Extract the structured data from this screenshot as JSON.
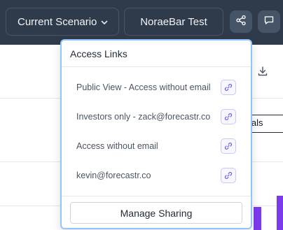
{
  "topbar": {
    "scenario_label": "Current Scenario",
    "project_label": "NoraeBar Test"
  },
  "background": {
    "toggle_label": "tuals"
  },
  "access_links": {
    "title": "Access Links",
    "links": [
      {
        "label": "Public View - Access without email"
      },
      {
        "label": "Investors only - zack@forecastr.co"
      },
      {
        "label": "Access without email"
      },
      {
        "label": "kevin@forecastr.co"
      }
    ],
    "manage_label": "Manage Sharing"
  },
  "colors": {
    "topbar_bg": "#2f3a4b",
    "popover_border": "#93c5fd",
    "link_icon": "#6d5fe0",
    "bar": "#7c3aed"
  }
}
